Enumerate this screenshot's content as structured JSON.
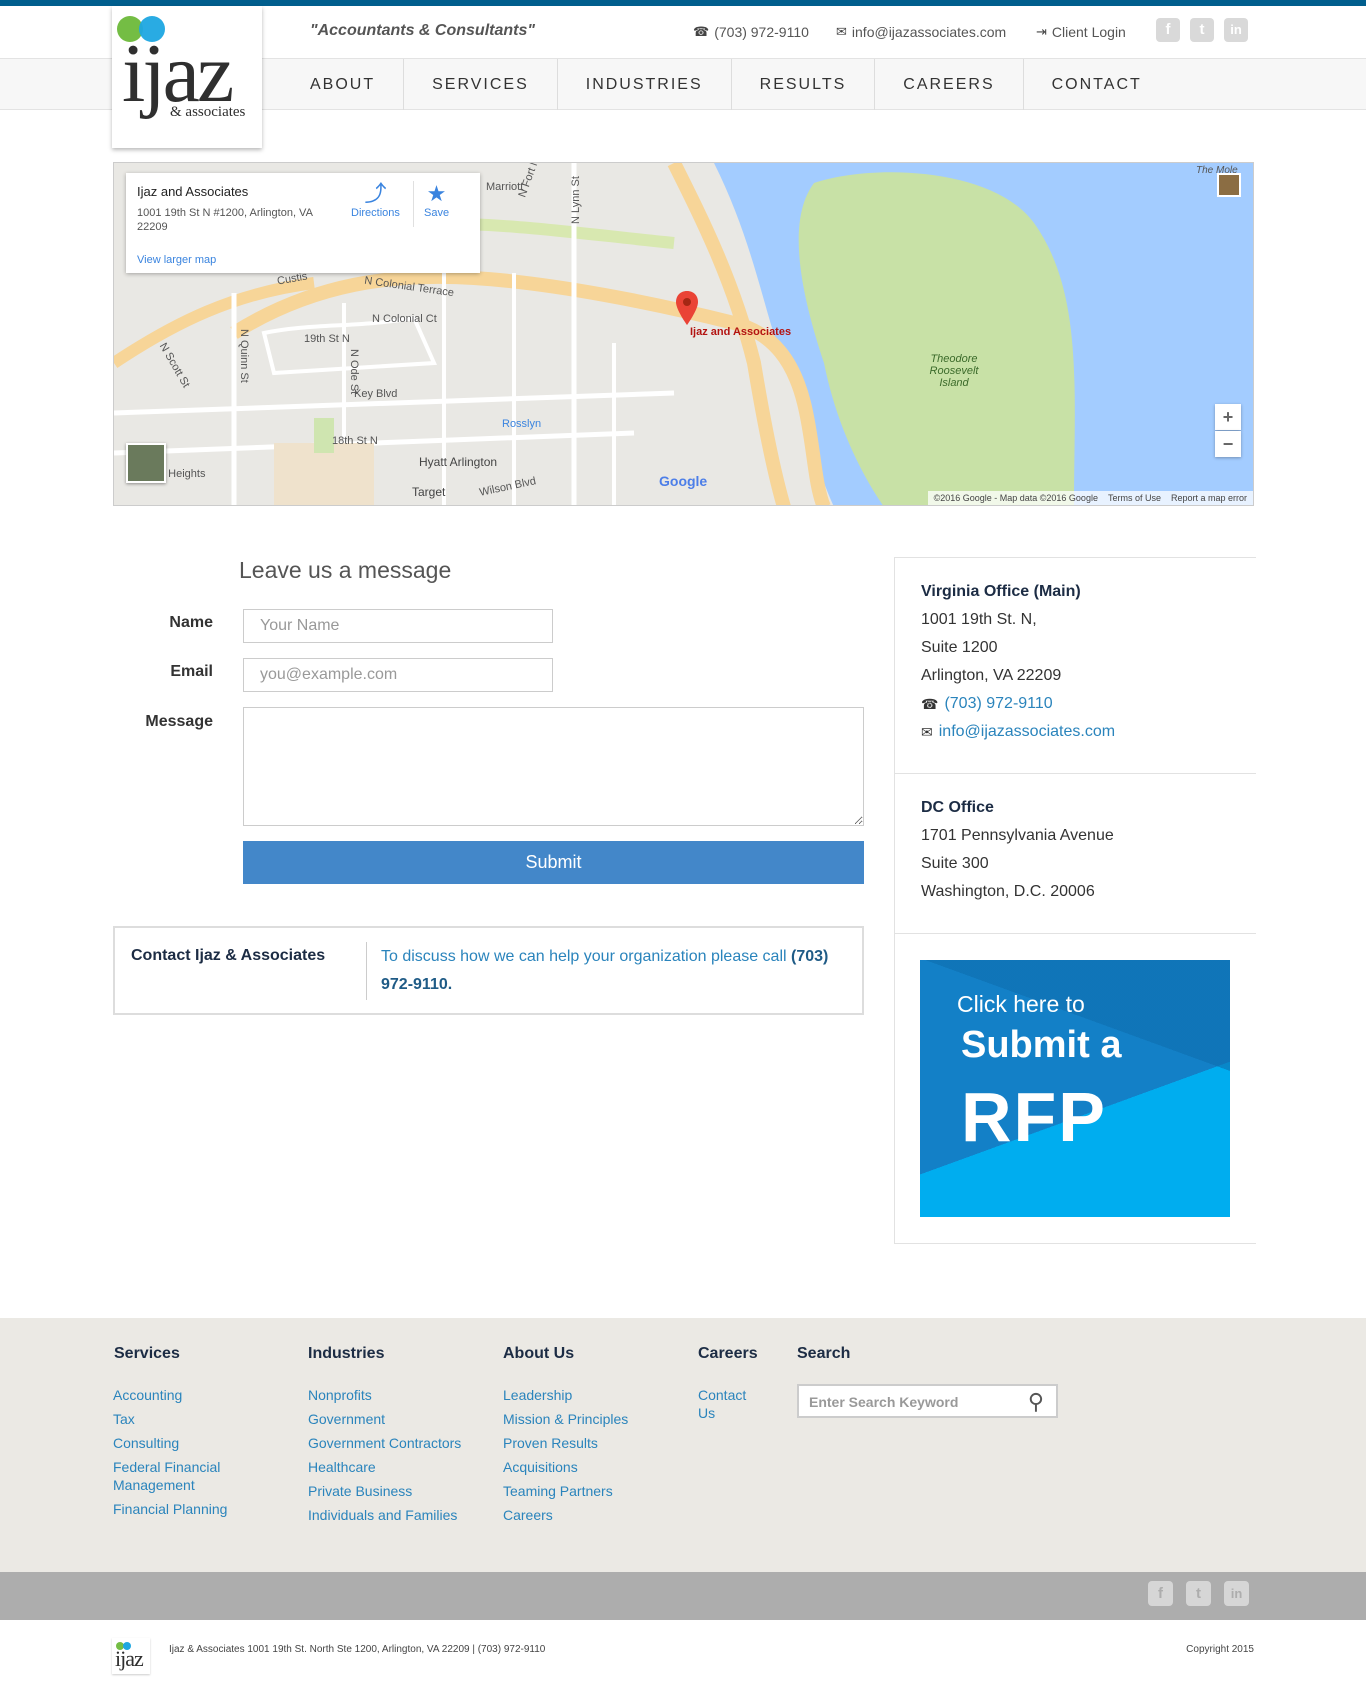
{
  "header": {
    "tagline": "\"Accountants & Consultants\"",
    "phone": "(703) 972-9110",
    "email": "info@ijazassociates.com",
    "client_login": "Client Login",
    "logo_main": "ijaz",
    "logo_sub": "& associates"
  },
  "nav": {
    "items": [
      "ABOUT",
      "SERVICES",
      "INDUSTRIES",
      "RESULTS",
      "CAREERS",
      "CONTACT"
    ]
  },
  "map": {
    "place_name": "Ijaz and Associates",
    "address": "1001 19th St N #1200, Arlington, VA 22209",
    "view_larger": "View larger map",
    "directions": "Directions",
    "save": "Save",
    "marker_label": "Ijaz and Associates",
    "labels": [
      "Marriott",
      "N Fort Myer Dr",
      "N Lynn St",
      "N Colonial Terrace",
      "N Colonial Ct",
      "19th St N",
      "N Quinn St",
      "N Ode St",
      "Key Blvd",
      "18th St N",
      "Hyatt Arlington",
      "Rosslyn",
      "Target",
      "Wilson Blvd",
      "N Scott St",
      "Rosslyn Heights",
      "Theodore Roosevelt Island",
      "The Mole",
      "Custis"
    ],
    "attribution": "©2016 Google - Map data ©2016 Google",
    "terms": "Terms of Use",
    "report": "Report a map error",
    "google": "Google"
  },
  "form": {
    "title": "Leave us a message",
    "name_label": "Name",
    "name_placeholder": "Your Name",
    "email_label": "Email",
    "email_placeholder": "you@example.com",
    "message_label": "Message",
    "submit": "Submit"
  },
  "contact_box": {
    "title": "Contact Ijaz & Associates",
    "text": "To discuss how we can help your organization please call",
    "phone": "(703) 972-9110",
    "period": "."
  },
  "offices": {
    "virginia": {
      "name": "Virginia Office (Main)",
      "line1": "1001 19th St. N,",
      "line2": "Suite 1200",
      "line3": "Arlington, VA 22209",
      "phone": "(703) 972-9110",
      "email": "info@ijazassociates.com"
    },
    "dc": {
      "name": "DC Office",
      "line1": "1701 Pennsylvania Avenue",
      "line2": "Suite 300",
      "line3": "Washington, D.C. 20006"
    }
  },
  "rfp": {
    "line1": "Click here to",
    "line2": "Submit a",
    "line3": "RFP"
  },
  "footer": {
    "services": {
      "title": "Services",
      "links": [
        "Accounting",
        "Tax",
        "Consulting",
        "Federal Financial Management",
        "Financial Planning"
      ]
    },
    "industries": {
      "title": "Industries",
      "links": [
        "Nonprofits",
        "Government",
        "Government Contractors",
        "Healthcare",
        "Private Business",
        "Individuals and Families"
      ]
    },
    "about": {
      "title": "About Us",
      "links": [
        "Leadership",
        "Mission & Principles",
        "Proven Results",
        "Acquisitions",
        "Teaming Partners",
        "Careers"
      ]
    },
    "careers": {
      "title": "Careers",
      "links": [
        "Contact Us"
      ]
    },
    "search": {
      "title": "Search",
      "placeholder": "Enter Search Keyword"
    }
  },
  "bottom": {
    "address": "Ijaz & Associates 1001 19th St. North Ste 1200, Arlington, VA 22209 | (703) 972-9110",
    "copyright": "Copyright 2015",
    "logo": "ijaz"
  },
  "colors": {
    "brand_blue": "#005e8d",
    "link_blue": "#2a84bc",
    "submit_blue": "#4387c9",
    "logo_green": "#74bd44",
    "logo_cyan": "#1ea7e1"
  }
}
